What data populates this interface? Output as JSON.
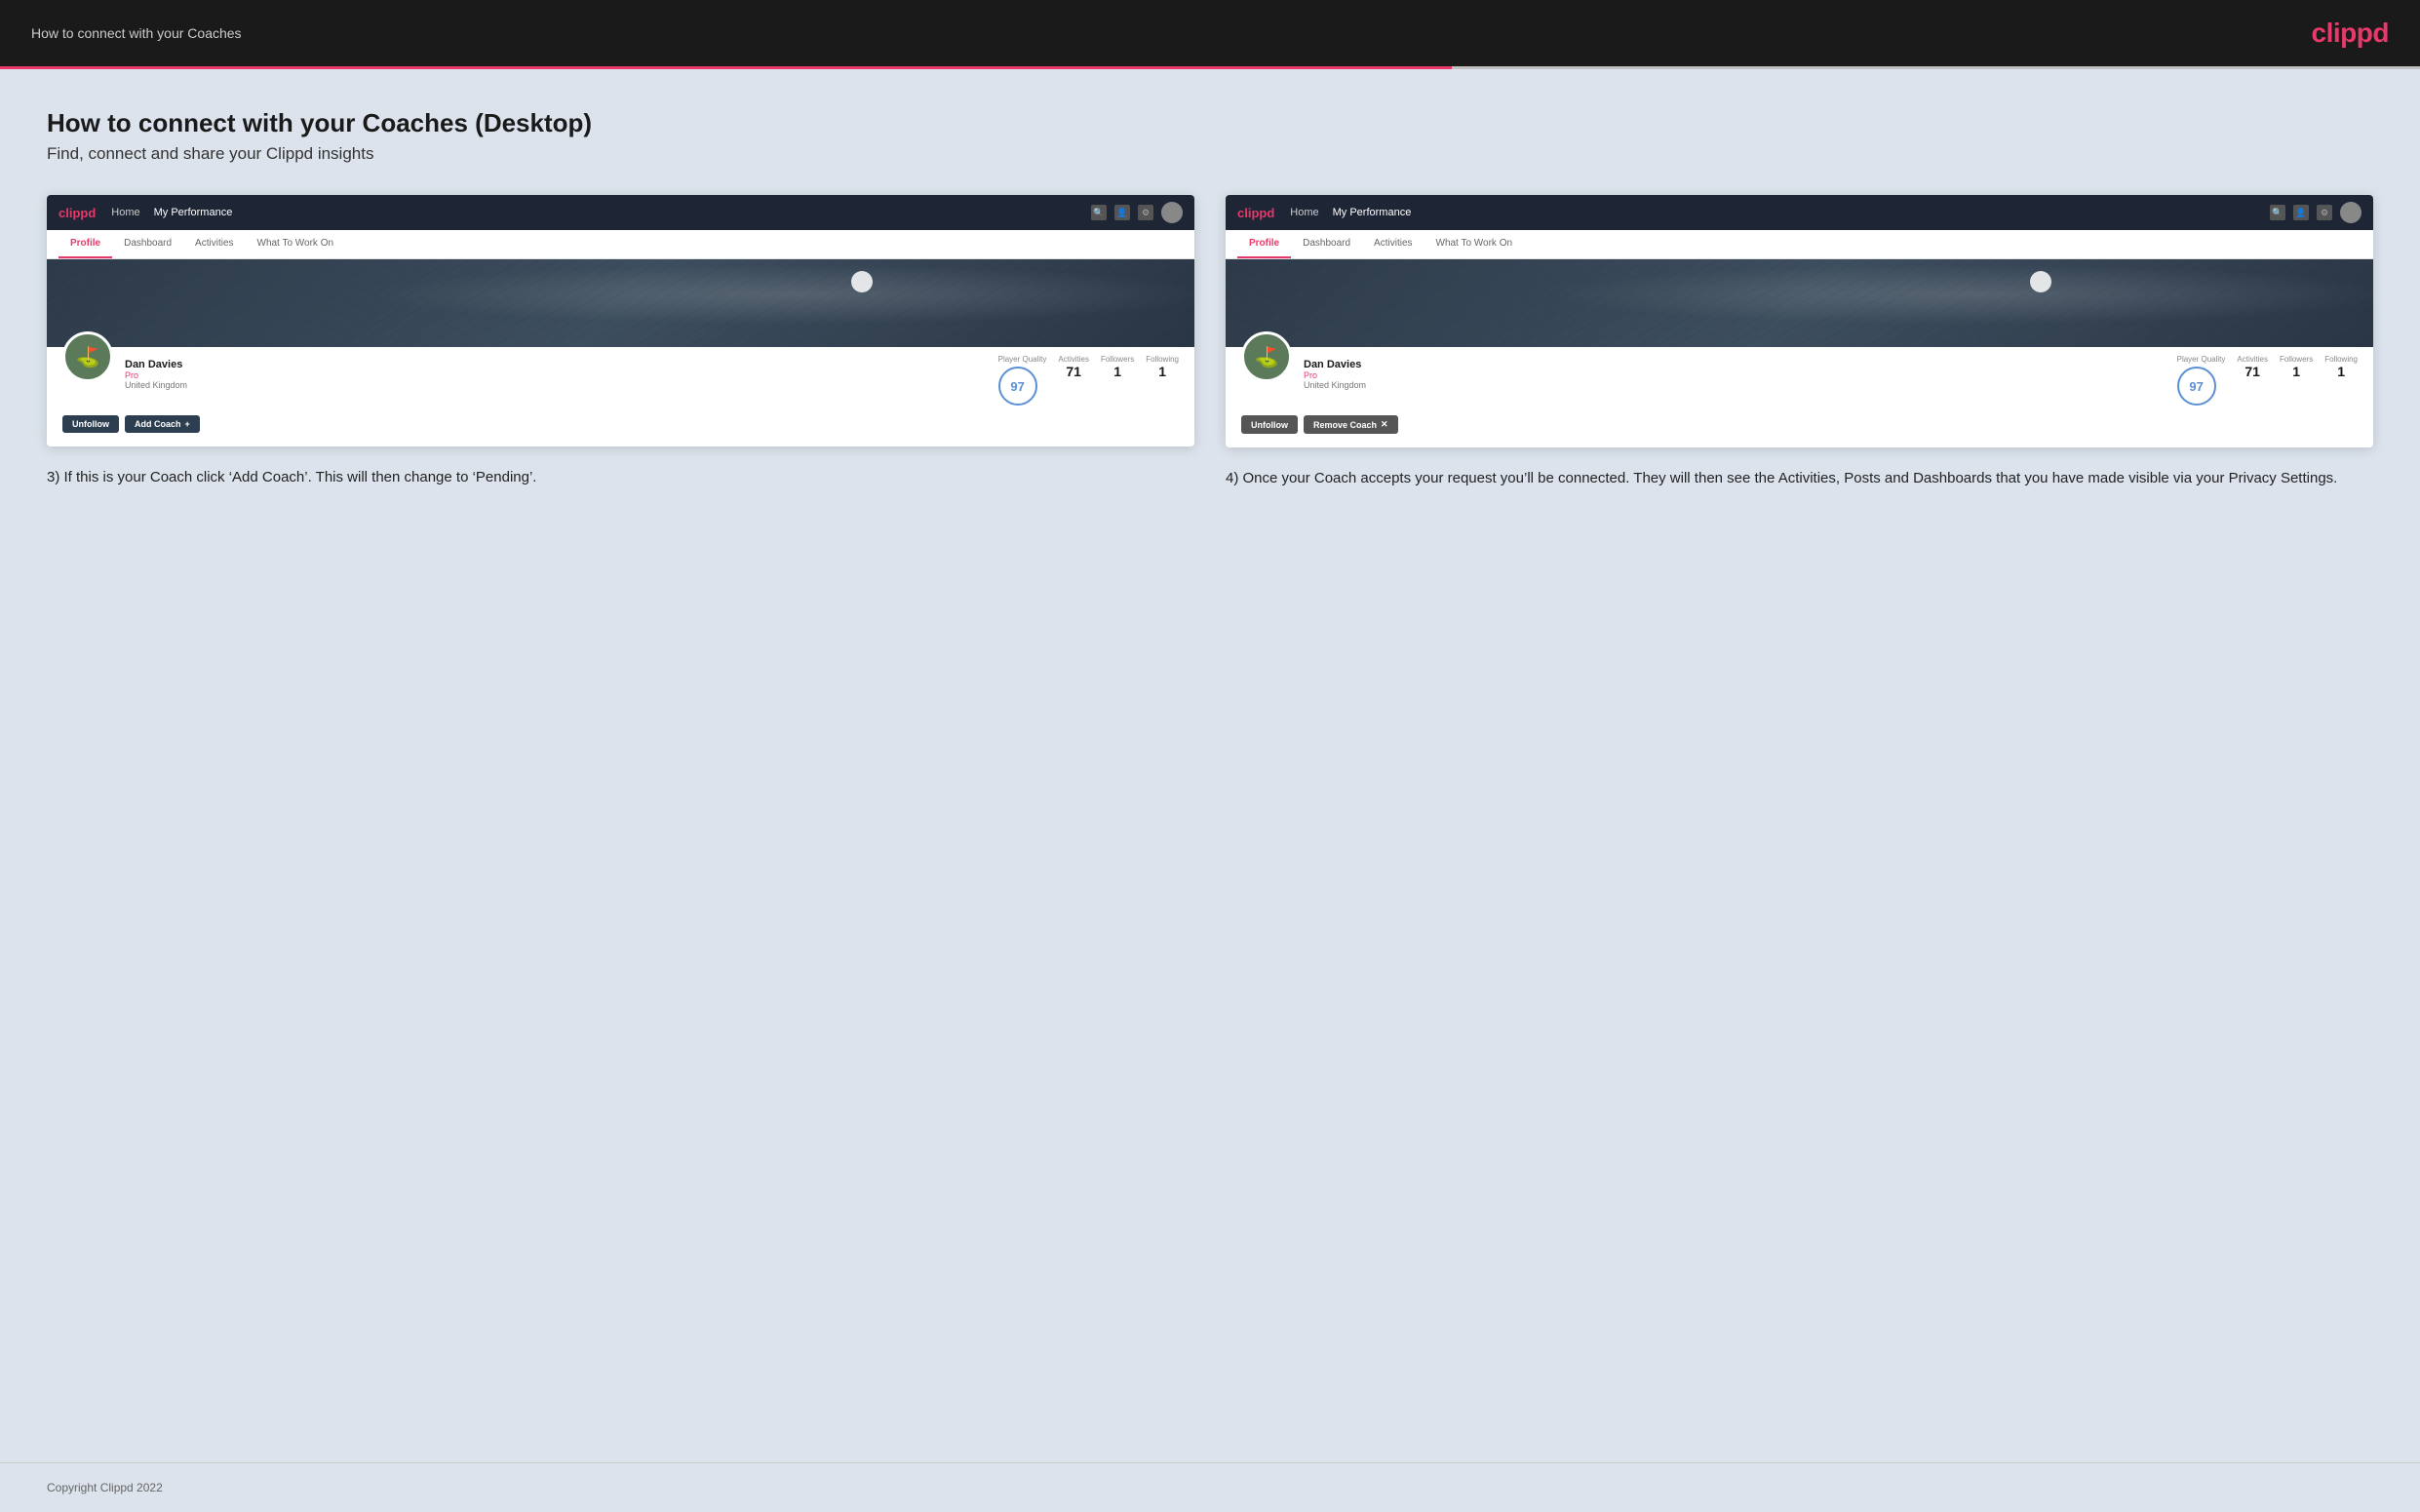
{
  "topbar": {
    "title": "How to connect with your Coaches",
    "logo": "clippd"
  },
  "page": {
    "heading": "How to connect with your Coaches (Desktop)",
    "subheading": "Find, connect and share your Clippd insights"
  },
  "screenshot1": {
    "navbar": {
      "logo": "clippd",
      "nav_items": [
        "Home",
        "My Performance"
      ],
      "active_nav": "My Performance"
    },
    "tabs": [
      "Profile",
      "Dashboard",
      "Activities",
      "What To Work On"
    ],
    "active_tab": "Profile",
    "profile": {
      "name": "Dan Davies",
      "role": "Pro",
      "location": "United Kingdom",
      "player_quality_label": "Player Quality",
      "player_quality_value": "97",
      "activities_label": "Activities",
      "activities_value": "71",
      "followers_label": "Followers",
      "followers_value": "1",
      "following_label": "Following",
      "following_value": "1"
    },
    "buttons": {
      "unfollow": "Unfollow",
      "add_coach": "Add Coach"
    }
  },
  "screenshot2": {
    "navbar": {
      "logo": "clippd",
      "nav_items": [
        "Home",
        "My Performance"
      ],
      "active_nav": "My Performance"
    },
    "tabs": [
      "Profile",
      "Dashboard",
      "Activities",
      "What To Work On"
    ],
    "active_tab": "Profile",
    "profile": {
      "name": "Dan Davies",
      "role": "Pro",
      "location": "United Kingdom",
      "player_quality_label": "Player Quality",
      "player_quality_value": "97",
      "activities_label": "Activities",
      "activities_value": "71",
      "followers_label": "Followers",
      "followers_value": "1",
      "following_label": "Following",
      "following_value": "1"
    },
    "buttons": {
      "unfollow": "Unfollow",
      "remove_coach": "Remove Coach"
    }
  },
  "descriptions": {
    "step3": "3) If this is your Coach click ‘Add Coach’. This will then change to ‘Pending’.",
    "step4": "4) Once your Coach accepts your request you’ll be connected. They will then see the Activities, Posts and Dashboards that you have made visible via your Privacy Settings."
  },
  "footer": {
    "copyright": "Copyright Clippd 2022"
  }
}
